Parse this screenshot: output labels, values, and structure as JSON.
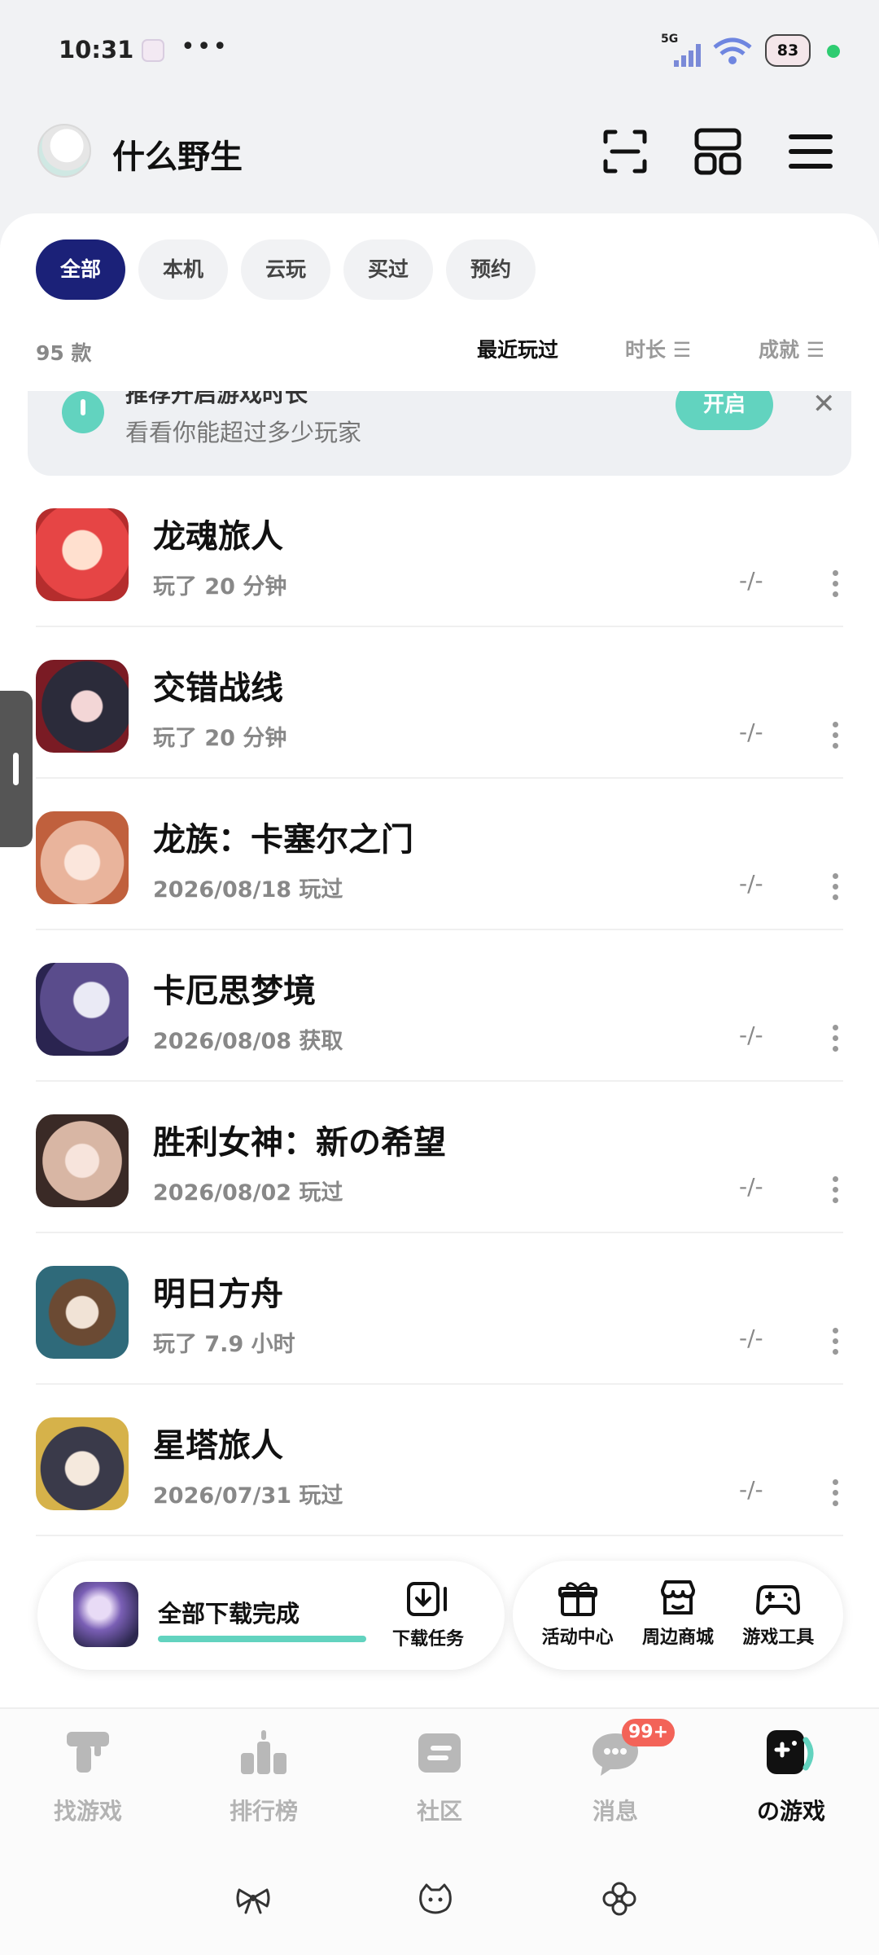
{
  "status_bar": {
    "time": "10:31",
    "more": "•••",
    "network": "5G",
    "battery": "83",
    "icons": [
      "app-notification-icon",
      "signal-icon",
      "wifi-icon",
      "battery-icon",
      "status-dot-icon"
    ]
  },
  "header": {
    "username": "什么野生",
    "icons": [
      "scan-icon",
      "layout-icon",
      "menu-icon"
    ]
  },
  "filters": {
    "tabs": [
      {
        "label": "全部",
        "active": true
      },
      {
        "label": "本机",
        "active": false
      },
      {
        "label": "云玩",
        "active": false
      },
      {
        "label": "买过",
        "active": false
      },
      {
        "label": "预约",
        "active": false
      }
    ]
  },
  "summary": {
    "count": "95 款"
  },
  "sort": {
    "recent": "最近玩过",
    "duration": "时长 ☰",
    "achievement": "成就 ☰"
  },
  "banner": {
    "title_clipped": "推荐开启游戏时长",
    "subtitle": "看看你能超过多少玩家",
    "button": "开启",
    "close": "✕"
  },
  "games": [
    {
      "name": "龙魂旅人",
      "meta": "玩了 20 分钟",
      "progress": "-/-",
      "accent": "#e64545"
    },
    {
      "name": "交错战线",
      "meta": "玩了 20 分钟",
      "progress": "-/-",
      "accent": "#2b2b3a"
    },
    {
      "name": "龙族：卡塞尔之门",
      "meta": "2026/08/18 玩过",
      "progress": "-/-",
      "accent": "#e9b49c"
    },
    {
      "name": "卡厄思梦境",
      "meta": "2026/08/08 获取",
      "progress": "-/-",
      "accent": "#5a4c8c"
    },
    {
      "name": "胜利女神：新の希望",
      "meta": "2026/08/02 玩过",
      "progress": "-/-",
      "accent": "#d8b6a4"
    },
    {
      "name": "明日方舟",
      "meta": "玩了 7.9 小时",
      "progress": "-/-",
      "accent": "#2f6a7a"
    },
    {
      "name": "星塔旅人",
      "meta": "2026/07/31 玩过",
      "progress": "-/-",
      "accent": "#3a3a4a"
    }
  ],
  "download": {
    "title": "全部下载完成",
    "task_label": "下载任务",
    "progress": 1.0
  },
  "tools": [
    {
      "label": "活动中心",
      "icon": "gift-icon"
    },
    {
      "label": "周边商城",
      "icon": "shop-icon"
    },
    {
      "label": "游戏工具",
      "icon": "gamepad-icon"
    }
  ],
  "bottom_nav": {
    "items": [
      {
        "label": "找游戏",
        "icon": "find-game-icon",
        "active": false
      },
      {
        "label": "排行榜",
        "icon": "leaderboard-icon",
        "active": false
      },
      {
        "label": "社区",
        "icon": "community-icon",
        "active": false
      },
      {
        "label": "消息",
        "icon": "message-icon",
        "active": false,
        "badge": "99+"
      },
      {
        "label": "の游戏",
        "icon": "my-games-icon",
        "active": true
      }
    ]
  },
  "colors": {
    "primary": "#1b2178",
    "accent": "#62d3bf",
    "badge": "#f36358"
  }
}
